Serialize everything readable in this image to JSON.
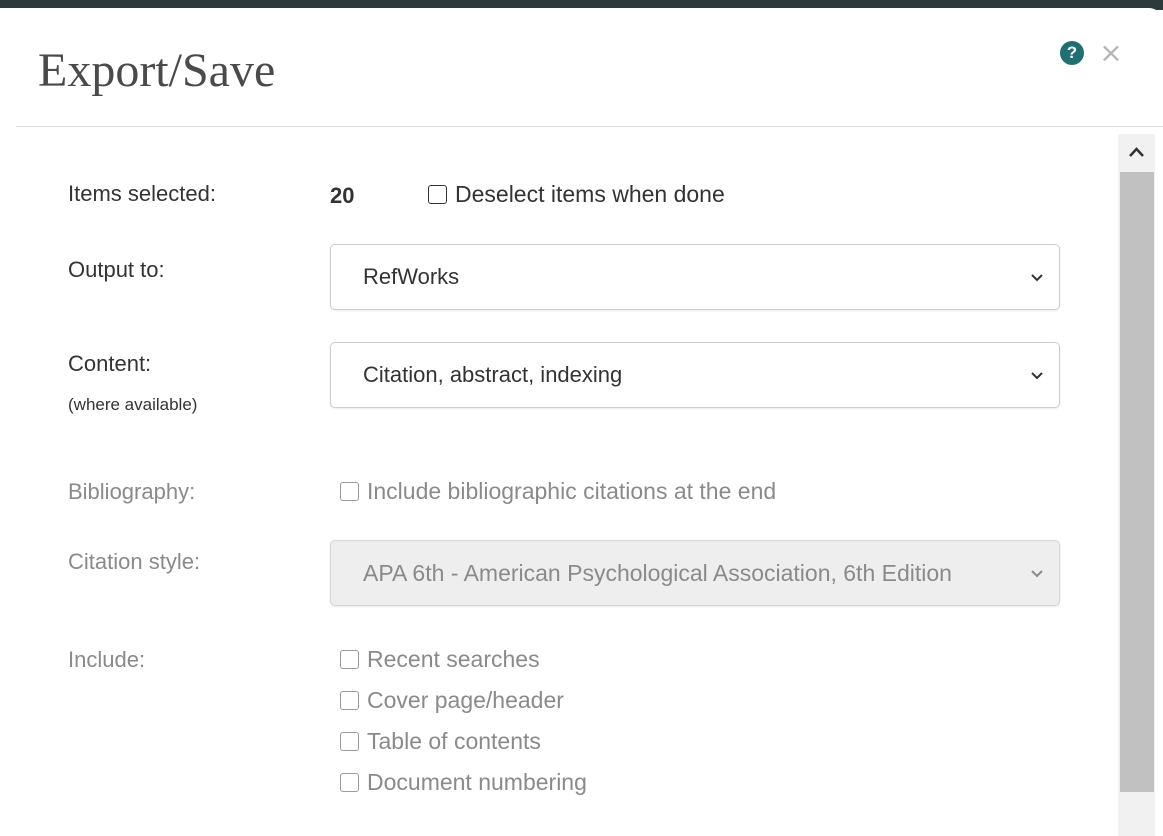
{
  "dialog": {
    "title": "Export/Save",
    "help_icon": "?",
    "close_icon": "×"
  },
  "form": {
    "items_selected": {
      "label": "Items selected:",
      "count": "20",
      "deselect_label": "Deselect items when done"
    },
    "output_to": {
      "label": "Output to:",
      "selected": "RefWorks"
    },
    "content": {
      "label": "Content:",
      "sublabel": "(where available)",
      "selected": "Citation, abstract, indexing"
    },
    "bibliography": {
      "label": "Bibliography:",
      "option_label": "Include bibliographic citations at the end"
    },
    "citation_style": {
      "label": "Citation style:",
      "selected": "APA 6th - American Psychological Association, 6th Edition"
    },
    "include": {
      "label": "Include:",
      "options": [
        "Recent searches",
        "Cover page/header",
        "Table of contents",
        "Document numbering"
      ]
    }
  },
  "scrollbar": {
    "up_arrow": "^"
  },
  "colors": {
    "help_icon_bg": "#1f6f75",
    "disabled_text": "#8a8a8a",
    "title_text": "#4a4a4a"
  }
}
